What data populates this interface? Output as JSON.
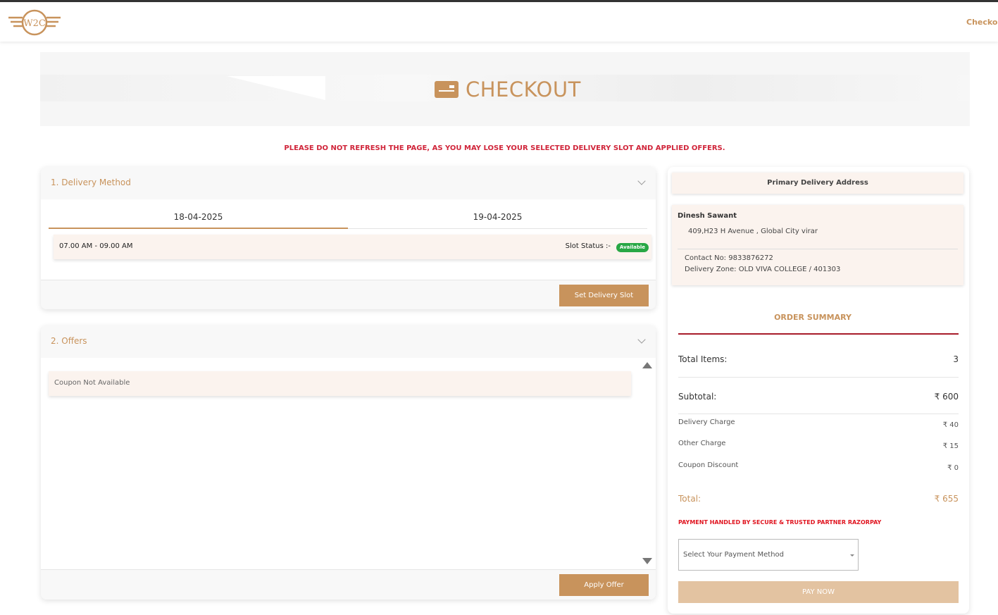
{
  "navbar": {
    "logo_text": "W2C",
    "checkout_link": "Checkout"
  },
  "hero": {
    "title": "CHECKOUT",
    "icon": "card-icon"
  },
  "warning": "PLEASE DO NOT REFRESH THE PAGE, AS YOU MAY LOSE YOUR SELECTED DELIVERY SLOT AND APPLIED OFFERS.",
  "delivery": {
    "title": "1. Delivery Method",
    "dates": [
      "18-04-2025",
      "19-04-2025"
    ],
    "selected_date": "18-04-2025",
    "slot": {
      "time": "07.00 AM - 09.00 AM",
      "status_label": "Slot Status :-",
      "status": "Available"
    },
    "set_button": "Set Delivery Slot"
  },
  "offers": {
    "title": "2. Offers",
    "coupon_message": "Coupon Not Available",
    "apply_button": "Apply Offer"
  },
  "address": {
    "heading": "Primary Delivery Address",
    "name": "Dinesh Sawant",
    "line": "409,H23 H Avenue , Global City virar",
    "contact": "Contact No: 9833876272",
    "zone": "Delivery Zone: OLD VIVA COLLEGE / 401303"
  },
  "order_summary": {
    "title": "ORDER SUMMARY",
    "total_items_label": "Total Items:",
    "total_items_value": "3",
    "subtotal_label": "Subtotal:",
    "subtotal_value": "₹ 600",
    "delivery_label": "Delivery Charge",
    "delivery_value": "₹ 40",
    "other_label": "Other Charge",
    "other_value": "₹ 15",
    "coupon_label": "Coupon Discount",
    "coupon_value": "₹ 0",
    "total_label": "Total:",
    "total_value": "₹ 655",
    "payment_note": "PAYMENT HANDLED BY SECURE & TRUSTED PARTNER RAZORPAY",
    "payment_select": "Select Your Payment Method",
    "pay_button": "PAY NOW"
  },
  "colors": {
    "accent": "#c8935c",
    "warning": "#d0253a",
    "success": "#28a745",
    "divider": "#a81c2a"
  }
}
